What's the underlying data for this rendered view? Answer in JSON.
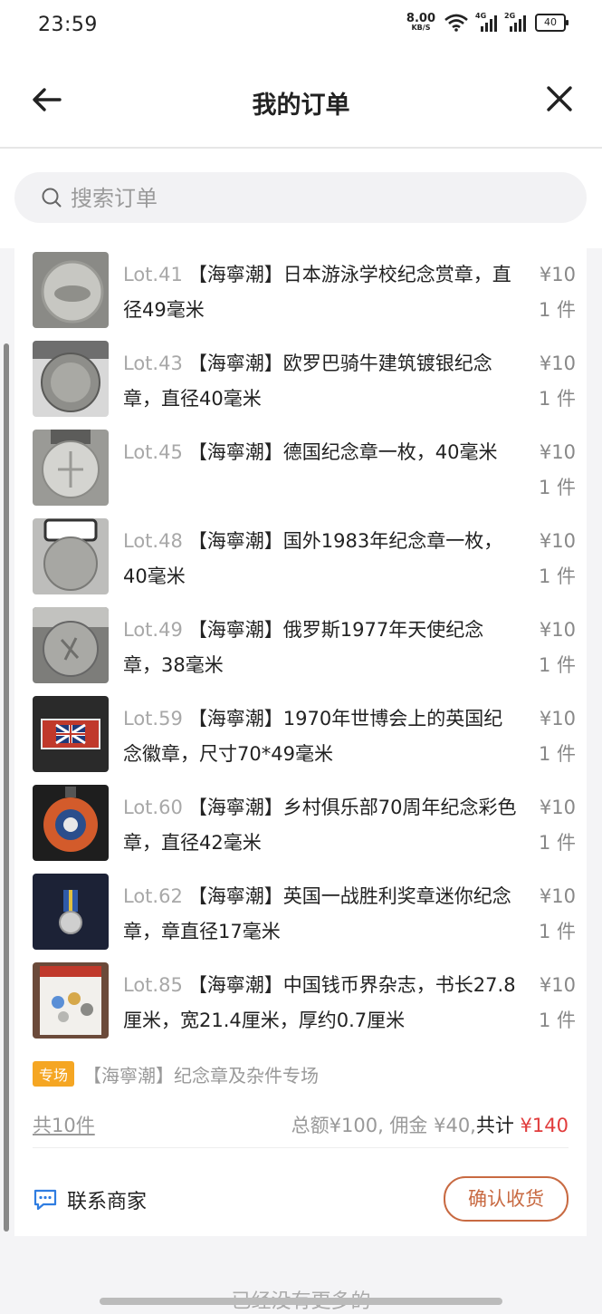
{
  "status_bar": {
    "time": "23:59",
    "net_speed": "8.00",
    "net_unit": "KB/S",
    "sig1": "4G",
    "sig2": "2G",
    "battery": "40"
  },
  "header": {
    "title": "我的订单"
  },
  "search": {
    "placeholder": "搜索订单"
  },
  "items": [
    {
      "lot": "Lot.41",
      "title": "【海寧潮】日本游泳学校纪念赏章，直径49毫米",
      "price": "¥10",
      "qty": "1 件"
    },
    {
      "lot": "Lot.43",
      "title": "【海寧潮】欧罗巴骑牛建筑镀银纪念章，直径40毫米",
      "price": "¥10",
      "qty": "1 件"
    },
    {
      "lot": "Lot.45",
      "title": "【海寧潮】德国纪念章一枚，40毫米",
      "price": "¥10",
      "qty": "1 件"
    },
    {
      "lot": "Lot.48",
      "title": "【海寧潮】国外1983年纪念章一枚，40毫米",
      "price": "¥10",
      "qty": "1 件"
    },
    {
      "lot": "Lot.49",
      "title": "【海寧潮】俄罗斯1977年天使纪念章，38毫米",
      "price": "¥10",
      "qty": "1 件"
    },
    {
      "lot": "Lot.59",
      "title": "【海寧潮】1970年世博会上的英国纪念徽章，尺寸70*49毫米",
      "price": "¥10",
      "qty": "1 件"
    },
    {
      "lot": "Lot.60",
      "title": "【海寧潮】乡村俱乐部70周年纪念彩色章，直径42毫米",
      "price": "¥10",
      "qty": "1 件"
    },
    {
      "lot": "Lot.62",
      "title": "【海寧潮】英国一战胜利奖章迷你纪念章，章直径17毫米",
      "price": "¥10",
      "qty": "1 件"
    },
    {
      "lot": "Lot.85",
      "title": "【海寧潮】中国钱币界杂志，书长27.8厘米，宽21.4厘米，厚约0.7厘米",
      "price": "¥10",
      "qty": "1 件"
    }
  ],
  "session": {
    "tag": "专场",
    "name": "【海寧潮】纪念章及杂件专场"
  },
  "summary": {
    "count": "共10件",
    "detail": "总额¥100, 佣金 ¥40,",
    "total_label": "共计",
    "total_amount": "¥140"
  },
  "actions": {
    "contact": "联系商家",
    "confirm": "确认收货"
  },
  "footer": {
    "text": "已经没有更多的"
  },
  "colors": {
    "accent": "#c86a42",
    "price_red": "#e13b3b",
    "tag_orange": "#f5a623"
  }
}
